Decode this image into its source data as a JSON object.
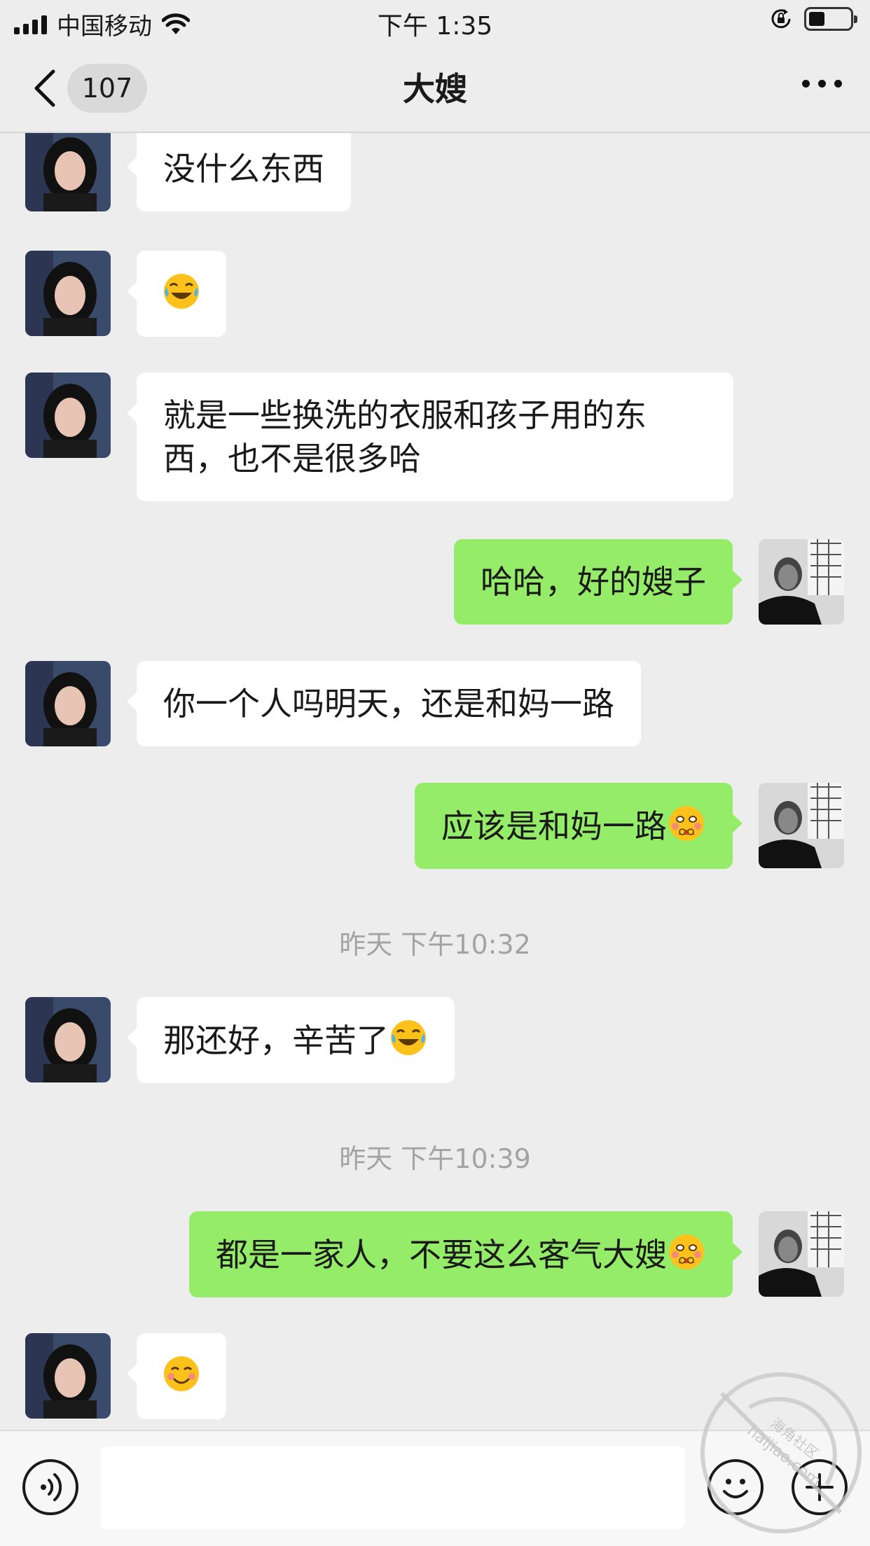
{
  "status_bar": {
    "carrier": "中国移动",
    "time": "下午 1:35"
  },
  "nav": {
    "unread_count": "107",
    "title": "大嫂"
  },
  "messages": [
    {
      "side": "recv",
      "text": "没什么东西"
    },
    {
      "side": "recv",
      "text": "",
      "emoji": "tears-of-joy-emoji"
    },
    {
      "side": "recv",
      "line1": "就是一些换洗的衣服和孩子用的东",
      "line2": "西，也不是很多哈"
    },
    {
      "side": "sent",
      "text": "哈哈，好的嫂子"
    },
    {
      "side": "recv",
      "text": "你一个人吗明天，还是和妈一路"
    },
    {
      "side": "sent",
      "text": "应该是和妈一路",
      "emoji": "shy-emoji"
    },
    {
      "side": "recv",
      "text": "那还好，辛苦了",
      "emoji": "tears-of-joy-emoji"
    },
    {
      "side": "sent",
      "text": "都是一家人，不要这么客气大嫂",
      "emoji": "shy-emoji"
    },
    {
      "side": "recv",
      "text": "",
      "emoji": "smile-emoji"
    }
  ],
  "timestamps": [
    "昨天 下午10:32",
    "昨天 下午10:39"
  ],
  "input": {
    "value": "",
    "placeholder": ""
  },
  "watermark": {
    "text1": "haijiao.com",
    "text2": "海角社区"
  },
  "colors": {
    "background": "#ededed",
    "sent_bubble": "#95ec69",
    "recv_bubble": "#ffffff",
    "timestamp": "#a3a3a3"
  }
}
